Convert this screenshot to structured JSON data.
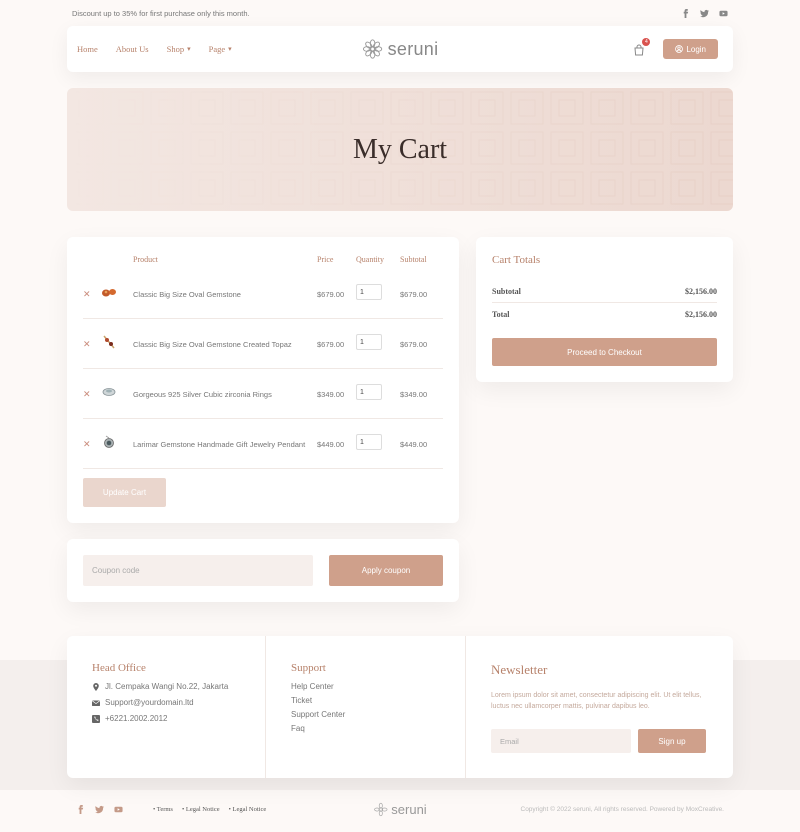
{
  "topbar": {
    "promo": "Discount up to 35% for first purchase only this month.",
    "socials": [
      "facebook-icon",
      "twitter-icon",
      "youtube-icon"
    ]
  },
  "header": {
    "nav": [
      {
        "label": "Home",
        "dropdown": false
      },
      {
        "label": "About Us",
        "dropdown": false
      },
      {
        "label": "Shop",
        "dropdown": true
      },
      {
        "label": "Page",
        "dropdown": true
      }
    ],
    "logo": "seruni",
    "cart_count": "4",
    "login_label": "Login"
  },
  "hero": {
    "title": "My Cart"
  },
  "cart": {
    "headers": {
      "product": "Product",
      "price": "Price",
      "quantity": "Quantity",
      "subtotal": "Subtotal"
    },
    "items": [
      {
        "name": "Classic Big Size Oval Gemstone",
        "price": "$679.00",
        "qty": "1",
        "subtotal": "$679.00"
      },
      {
        "name": "Classic Big Size Oval Gemstone Created Topaz",
        "price": "$679.00",
        "qty": "1",
        "subtotal": "$679.00"
      },
      {
        "name": "Gorgeous 925 Silver Cubic zirconia Rings",
        "price": "$349.00",
        "qty": "1",
        "subtotal": "$349.00"
      },
      {
        "name": "Larimar Gemstone Handmade Gift Jewelry Pendant",
        "price": "$449.00",
        "qty": "1",
        "subtotal": "$449.00"
      }
    ],
    "update_label": "Update Cart"
  },
  "totals": {
    "title": "Cart Totals",
    "subtotal_label": "Subtotal",
    "subtotal_value": "$2,156.00",
    "total_label": "Total",
    "total_value": "$2,156.00",
    "checkout_label": "Proceed to Checkout"
  },
  "coupon": {
    "placeholder": "Coupon code",
    "button": "Apply coupon"
  },
  "footer": {
    "head_office": {
      "title": "Head Office",
      "address": "Jl. Cempaka Wangi No.22, Jakarta",
      "email": "Support@yourdomain.ltd",
      "phone": "+6221.2002.2012"
    },
    "support": {
      "title": "Support",
      "links": [
        "Help Center",
        "Ticket",
        "Support Center",
        "Faq"
      ]
    },
    "newsletter": {
      "title": "Newsletter",
      "text": "Lorem ipsum dolor sit amet, consectetur adipiscing elit. Ut elit tellus, luctus nec ullamcorper mattis, pulvinar dapibus leo.",
      "email_placeholder": "Email",
      "button": "Sign up"
    }
  },
  "bottombar": {
    "legal": [
      "Terms",
      "Legal Notice",
      "Legal Notice"
    ],
    "logo": "seruni",
    "copyright": "Copyright © 2022 seruni, All rights reserved. Powered by MoxCreative."
  },
  "colors": {
    "accent": "#cfa08b",
    "accent_text": "#b7826b",
    "badge": "#d9534f"
  }
}
